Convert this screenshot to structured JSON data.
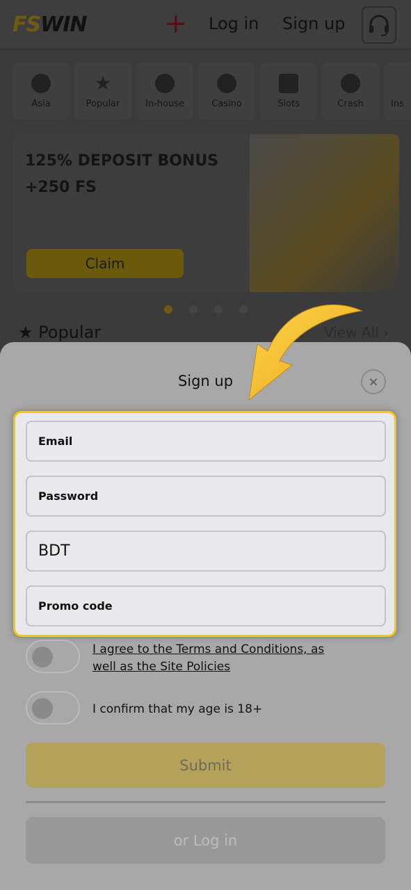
{
  "header": {
    "logo": "FSWIN",
    "logo_fs": "FS",
    "logo_win": "WIN",
    "login": "Log in",
    "signup": "Sign up"
  },
  "categories": [
    {
      "label": "Asia",
      "icon": "yin-yang-icon"
    },
    {
      "label": "Popular",
      "icon": "star-icon"
    },
    {
      "label": "In-house",
      "icon": "in-house-icon"
    },
    {
      "label": "Casino",
      "icon": "roulette-icon"
    },
    {
      "label": "Slots",
      "icon": "slot-machine-icon"
    },
    {
      "label": "Crash",
      "icon": "plane-icon"
    },
    {
      "label": "Ins",
      "icon": "instant-icon"
    }
  ],
  "banner": {
    "line1": "125% DEPOSIT BONUS",
    "line2": "+250 FS",
    "claim": "Claim",
    "slide_active": 1,
    "slide_count": 4
  },
  "section": {
    "title": "Popular",
    "view_all": "View All ›"
  },
  "modal": {
    "title": "Sign up",
    "close": "×",
    "fields": {
      "email": "Email",
      "password": "Password",
      "currency": "BDT",
      "promo": "Promo code"
    },
    "terms_line1": "I agree to the Terms and Conditions, as",
    "terms_line2": "well as the Site Policies",
    "terms_checked": false,
    "age": "I confirm that my age is 18+",
    "age_checked": false,
    "submit": "Submit",
    "login": "or Log in"
  },
  "colors": {
    "accent": "#f2c811",
    "modal_bg": "#a8a8a8"
  }
}
